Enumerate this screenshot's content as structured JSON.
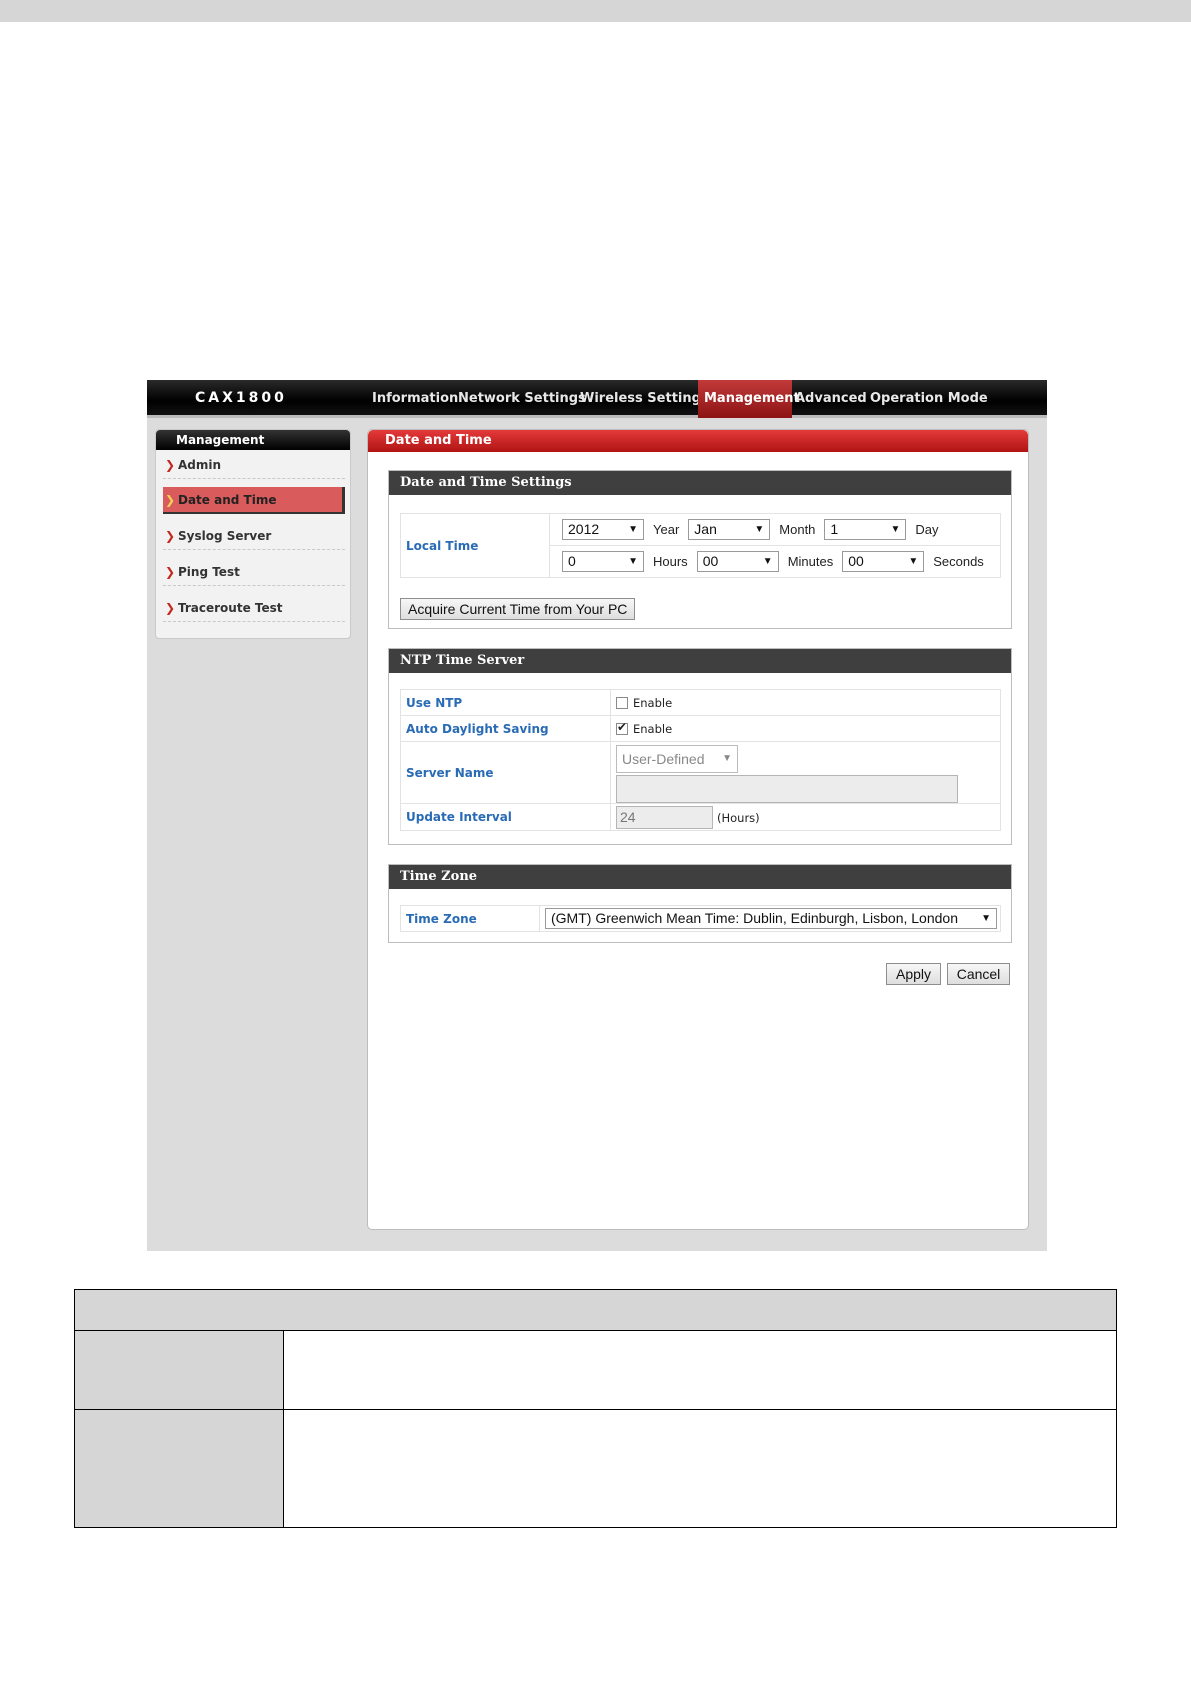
{
  "app": {
    "brand": "CAX1800",
    "nav": [
      "Information",
      "Network Settings",
      "Wireless Settings",
      "Management",
      "Advanced",
      "Operation Mode"
    ],
    "active_nav": "Management"
  },
  "sidebar": {
    "title": "Management",
    "items": [
      {
        "label": "Admin"
      },
      {
        "label": "Date and Time"
      },
      {
        "label": "Syslog Server"
      },
      {
        "label": "Ping Test"
      },
      {
        "label": "Traceroute Test"
      }
    ],
    "active_item": "Date and Time"
  },
  "main": {
    "title": "Date and Time",
    "datetime": {
      "title": "Date and Time Settings",
      "local_time_label": "Local Time",
      "year_value": "2012",
      "year_unit": "Year",
      "month_value": "Jan",
      "month_unit": "Month",
      "day_value": "1",
      "day_unit": "Day",
      "hours_value": "0",
      "hours_unit": "Hours",
      "minutes_value": "00",
      "minutes_unit": "Minutes",
      "seconds_value": "00",
      "seconds_unit": "Seconds",
      "acquire_button": "Acquire Current Time from Your PC"
    },
    "ntp": {
      "title": "NTP Time Server",
      "use_ntp_label": "Use NTP",
      "use_ntp_checked": false,
      "use_ntp_text": "Enable",
      "auto_dst_label": "Auto Daylight Saving",
      "auto_dst_checked": true,
      "auto_dst_text": "Enable",
      "server_name_label": "Server Name",
      "server_select": "User-Defined",
      "server_input": "",
      "update_interval_label": "Update Interval",
      "update_interval_value": "24",
      "update_interval_unit": "(Hours)"
    },
    "timezone": {
      "title": "Time Zone",
      "label": "Time Zone",
      "value": "(GMT) Greenwich Mean Time: Dublin, Edinburgh, Lisbon, London"
    },
    "apply_button": "Apply",
    "cancel_button": "Cancel"
  }
}
